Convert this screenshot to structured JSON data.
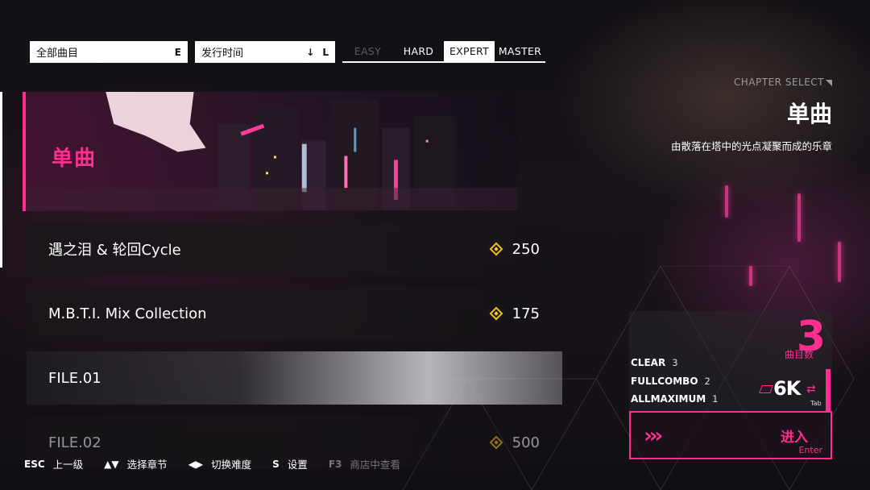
{
  "filters": {
    "category": {
      "label": "全部曲目",
      "key": "E"
    },
    "sort": {
      "label": "发行时间",
      "arrow": "↓",
      "key": "L"
    }
  },
  "difficulties": [
    {
      "label": "EASY",
      "state": "disabled"
    },
    {
      "label": "HARD",
      "state": "normal"
    },
    {
      "label": "EXPERT",
      "state": "selected"
    },
    {
      "label": "MASTER",
      "state": "normal"
    }
  ],
  "chapter": {
    "title": "单曲"
  },
  "songs": [
    {
      "name": "遇之泪 & 轮回Cycle",
      "rating": "250"
    },
    {
      "name": "M.B.T.I. Mix Collection",
      "rating": "175"
    },
    {
      "name": "FILE.01",
      "rating": ""
    },
    {
      "name": "FILE.02",
      "rating": "500"
    }
  ],
  "panel": {
    "chapter_select": "CHAPTER SELECT",
    "name": "单曲",
    "description": "由散落在塔中的光点凝聚而成的乐章",
    "count_label": "曲目数",
    "count": "3",
    "stats": [
      {
        "label": "CLEAR",
        "value": "3"
      },
      {
        "label": "FULLCOMBO",
        "value": "2"
      },
      {
        "label": "ALLMAXIMUM",
        "value": "1"
      }
    ],
    "mode": "6K",
    "mode_key": "Tab",
    "enter_label": "进入",
    "enter_key": "Enter"
  },
  "hints": [
    {
      "key": "ESC",
      "label": "上一级",
      "dim": false
    },
    {
      "key": "▲▼",
      "label": "选择章节",
      "dim": false
    },
    {
      "key": "◀▶",
      "label": "切换难度",
      "dim": false
    },
    {
      "key": "S",
      "label": "设置",
      "dim": false
    },
    {
      "key": "F3",
      "label": "商店中查看",
      "dim": true
    }
  ],
  "colors": {
    "accent": "#ff2e8f",
    "rating": "#f2c21b"
  }
}
